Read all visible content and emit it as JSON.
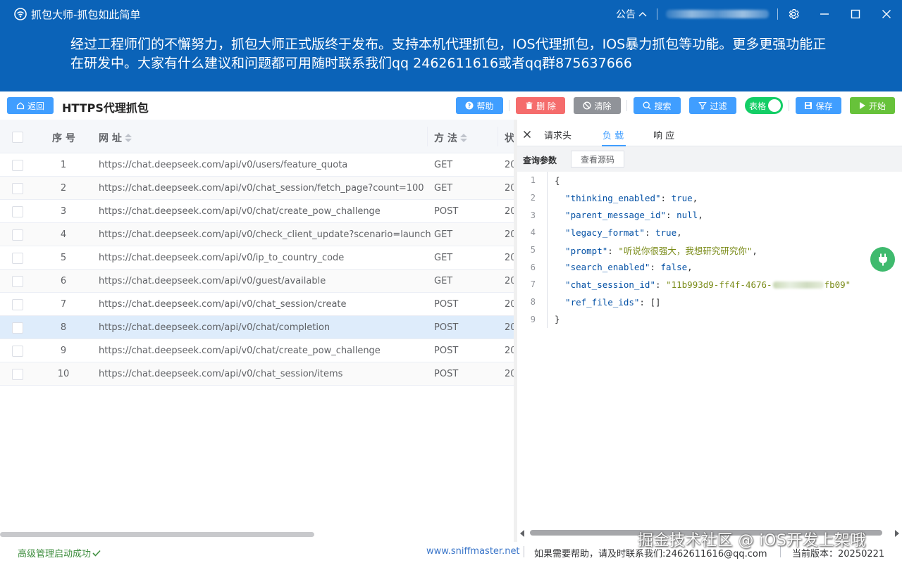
{
  "window": {
    "title": "抓包大师-抓包如此简单",
    "notice_label": "公告",
    "user_masked": true
  },
  "announcement": "经过工程师们的不懈努力，抓包大师正式版终于发布。支持本机代理抓包，IOS代理抓包，IOS暴力抓包等功能。更多更强功能正在研发中。大家有什么建议和问题都可用随时联系我们qq 2462611616或者qq群875637666",
  "toolbar": {
    "back_label": "返回",
    "page_title": "HTTPS代理抓包",
    "help_label": "帮助",
    "delete_label": "删 除",
    "clear_label": "清除",
    "search_label": "搜索",
    "filter_label": "过滤",
    "table_toggle_label": "表格",
    "table_toggle_on": true,
    "save_label": "保存",
    "start_label": "开始"
  },
  "table": {
    "headers": {
      "index": "序 号",
      "url": "网 址",
      "method": "方 法",
      "status": "状"
    },
    "rows": [
      {
        "index": "1",
        "url": "https://chat.deepseek.com/api/v0/users/feature_quota",
        "method": "GET",
        "status": "20"
      },
      {
        "index": "2",
        "url": "https://chat.deepseek.com/api/v0/chat_session/fetch_page?count=100",
        "method": "GET",
        "status": "20"
      },
      {
        "index": "3",
        "url": "https://chat.deepseek.com/api/v0/chat/create_pow_challenge",
        "method": "POST",
        "status": "20"
      },
      {
        "index": "4",
        "url": "https://chat.deepseek.com/api/v0/check_client_update?scenario=launch",
        "method": "GET",
        "status": "20"
      },
      {
        "index": "5",
        "url": "https://chat.deepseek.com/api/v0/ip_to_country_code",
        "method": "GET",
        "status": "20"
      },
      {
        "index": "6",
        "url": "https://chat.deepseek.com/api/v0/guest/available",
        "method": "GET",
        "status": "20"
      },
      {
        "index": "7",
        "url": "https://chat.deepseek.com/api/v0/chat_session/create",
        "method": "POST",
        "status": "20"
      },
      {
        "index": "8",
        "url": "https://chat.deepseek.com/api/v0/chat/completion",
        "method": "POST",
        "status": "20"
      },
      {
        "index": "9",
        "url": "https://chat.deepseek.com/api/v0/chat/create_pow_challenge",
        "method": "POST",
        "status": "20"
      },
      {
        "index": "10",
        "url": "https://chat.deepseek.com/api/v0/chat_session/items",
        "method": "POST",
        "status": "20"
      }
    ],
    "selected_index": "8"
  },
  "detail": {
    "tabs": [
      "请求头",
      "负 载",
      "响 应"
    ],
    "active_tab": "负 载",
    "query_params_label": "查询参数",
    "view_source_label": "查看源码",
    "code_lines": [
      {
        "n": "1",
        "parts": [
          {
            "t": "{",
            "c": "b"
          }
        ]
      },
      {
        "n": "2",
        "parts": [
          {
            "t": "  \"thinking_enabled\"",
            "c": "key"
          },
          {
            "t": ": ",
            "c": "p"
          },
          {
            "t": "true",
            "c": "val"
          },
          {
            "t": ",",
            "c": "p"
          }
        ]
      },
      {
        "n": "3",
        "parts": [
          {
            "t": "  \"parent_message_id\"",
            "c": "key"
          },
          {
            "t": ": ",
            "c": "p"
          },
          {
            "t": "null",
            "c": "val"
          },
          {
            "t": ",",
            "c": "p"
          }
        ]
      },
      {
        "n": "4",
        "parts": [
          {
            "t": "  \"legacy_format\"",
            "c": "key"
          },
          {
            "t": ": ",
            "c": "p"
          },
          {
            "t": "true",
            "c": "val"
          },
          {
            "t": ",",
            "c": "p"
          }
        ]
      },
      {
        "n": "5",
        "parts": [
          {
            "t": "  \"prompt\"",
            "c": "key"
          },
          {
            "t": ": ",
            "c": "p"
          },
          {
            "t": "\"听说你很强大，我想研究研究你\"",
            "c": "str"
          },
          {
            "t": ",",
            "c": "p"
          }
        ]
      },
      {
        "n": "6",
        "parts": [
          {
            "t": "  \"search_enabled\"",
            "c": "key"
          },
          {
            "t": ": ",
            "c": "p"
          },
          {
            "t": "false",
            "c": "val"
          },
          {
            "t": ",",
            "c": "p"
          }
        ]
      },
      {
        "n": "7",
        "parts": [
          {
            "t": "  \"chat_session_id\"",
            "c": "key"
          },
          {
            "t": ": ",
            "c": "p"
          },
          {
            "t": "\"11b993d9-ff4f-4676-",
            "c": "str"
          },
          {
            "t": "",
            "c": "blur"
          },
          {
            "t": "fb09\"",
            "c": "str"
          }
        ]
      },
      {
        "n": "8",
        "parts": [
          {
            "t": "  \"ref_file_ids\"",
            "c": "key"
          },
          {
            "t": ": []",
            "c": "p"
          }
        ]
      },
      {
        "n": "9",
        "parts": [
          {
            "t": "}",
            "c": "b"
          }
        ]
      }
    ]
  },
  "statusbar": {
    "status_text": "高级管理启动成功",
    "website": "www.sniffmaster.net",
    "help_text": "如果需要帮助，请及时联系我们:2462611616@qq.com",
    "version_text": "当前版本：20250221"
  },
  "watermark": "掘金技术社区 @ iOS开发上架哦",
  "colors": {
    "header_blue": "#0b63b8",
    "help": "#409eff",
    "delete": "#f56c6c",
    "clear": "#909399",
    "search": "#409eff",
    "filter": "#409eff",
    "toggle": "#13ce66",
    "save": "#409eff",
    "start": "#67c23a",
    "selected_row": "#deecfb",
    "plug_fab": "#3fba6e"
  },
  "icons": {
    "logo": "wifi-logo-icon",
    "settings": "gear-icon",
    "minimize": "minimize-icon",
    "maximize": "maximize-icon",
    "close": "close-icon",
    "plug": "plug-icon"
  }
}
